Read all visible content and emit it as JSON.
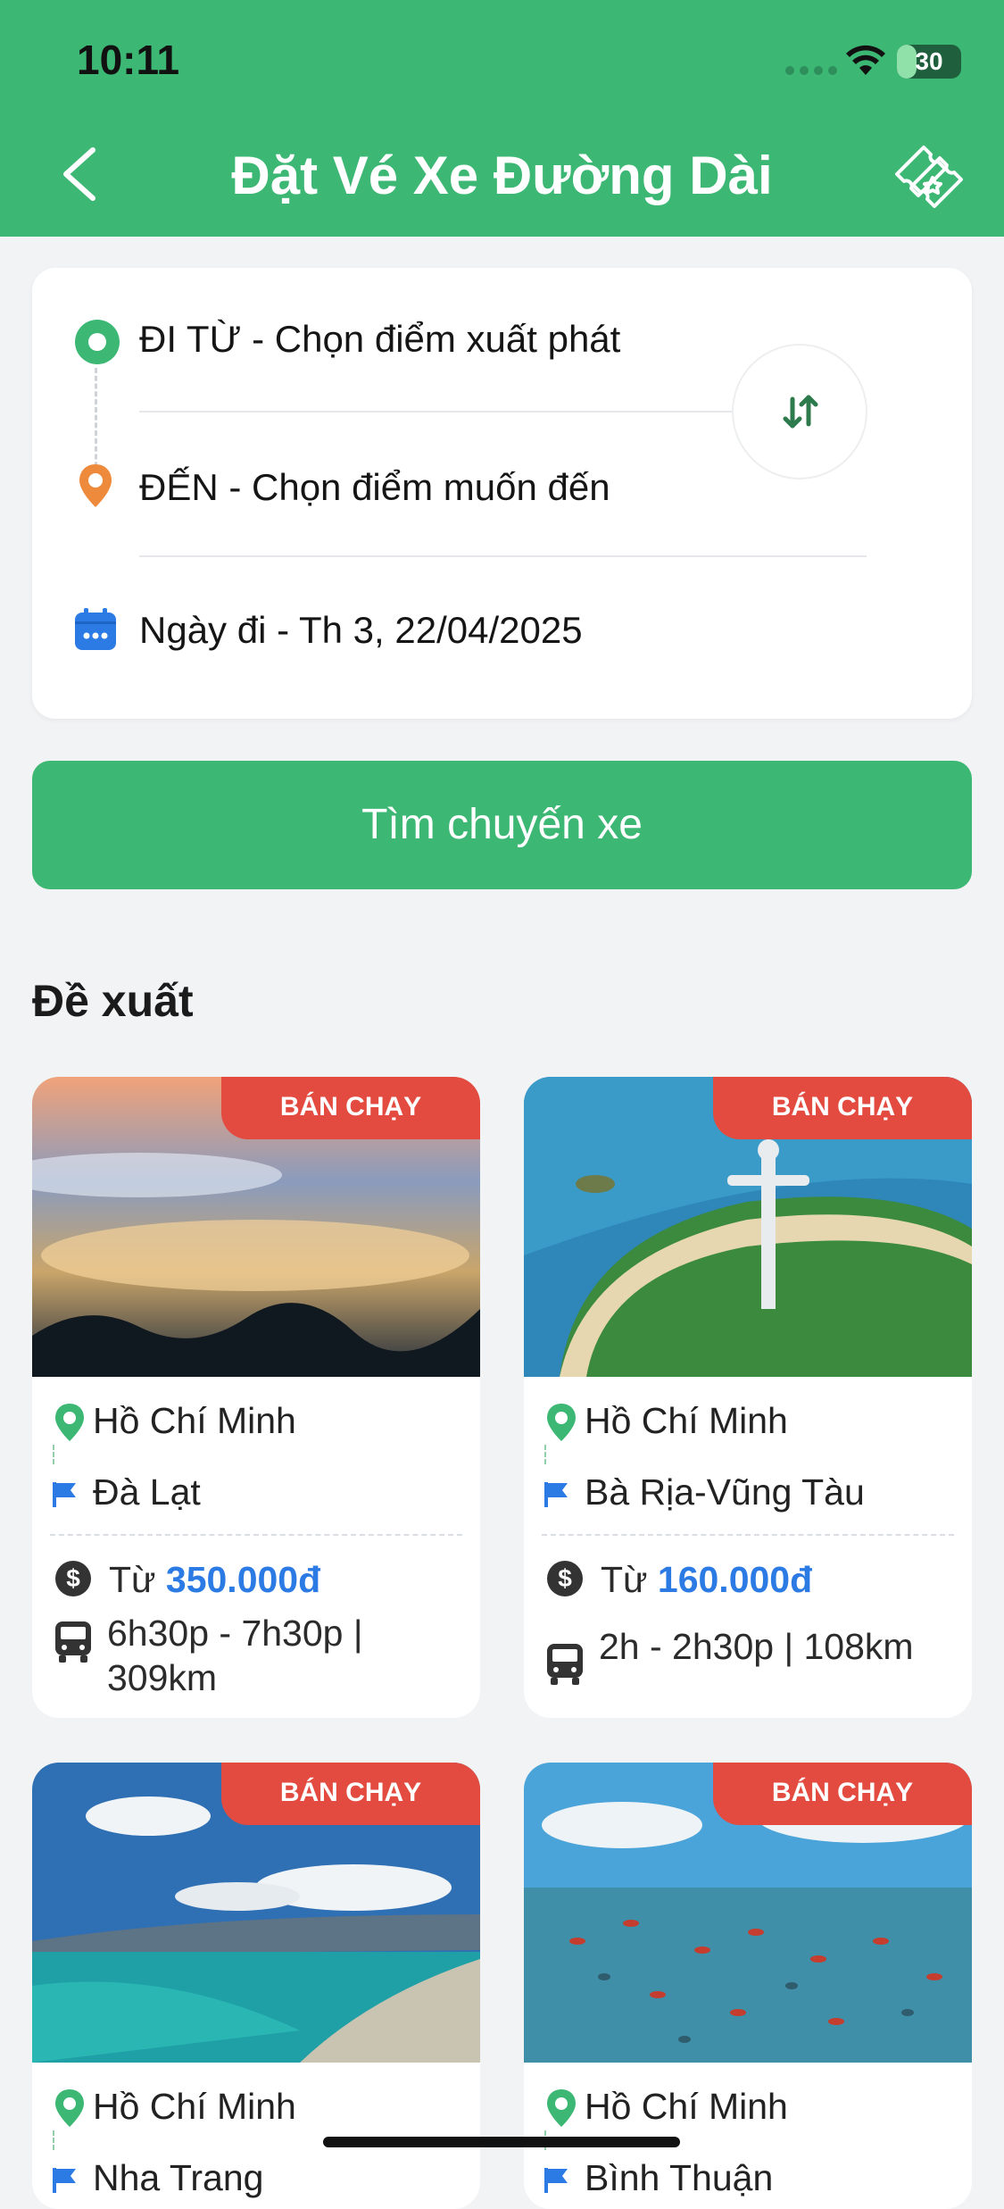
{
  "status_bar": {
    "time": "10:11",
    "battery": "30",
    "battery_level": 0.3
  },
  "header": {
    "title": "Đặt Vé Xe Đường Dài",
    "back_icon": "chevron-left-icon",
    "ticket_icon": "ticket-icon"
  },
  "search": {
    "from_label": "ĐI TỪ - Chọn điểm xuất phát",
    "to_label": "ĐẾN - Chọn điểm muốn đến",
    "date_label": "Ngày đi - Th 3, 22/04/2025",
    "search_button": "Tìm chuyến xe"
  },
  "suggest": {
    "title": "Đề xuất",
    "cards": [
      {
        "badge": "BÁN CHẠY",
        "from": "Hồ Chí Minh",
        "to": "Đà Lạt",
        "price_prefix": "Từ ",
        "price": "350.000đ",
        "duration": "6h30p - 7h30p | 309km"
      },
      {
        "badge": "BÁN CHẠY",
        "from": "Hồ Chí Minh",
        "to": "Bà Rịa-Vũng Tàu",
        "price_prefix": "Từ ",
        "price": "160.000đ",
        "duration": "2h - 2h30p | 108km"
      },
      {
        "badge": "BÁN CHẠY",
        "from": "Hồ Chí Minh",
        "to": "Nha Trang"
      },
      {
        "badge": "BÁN CHẠY",
        "from": "Hồ Chí Minh",
        "to": "Bình Thuận"
      }
    ]
  },
  "colors": {
    "primary": "#3cb774",
    "badge": "#e34b40",
    "price": "#2c7be5",
    "flag": "#2c7be5"
  }
}
